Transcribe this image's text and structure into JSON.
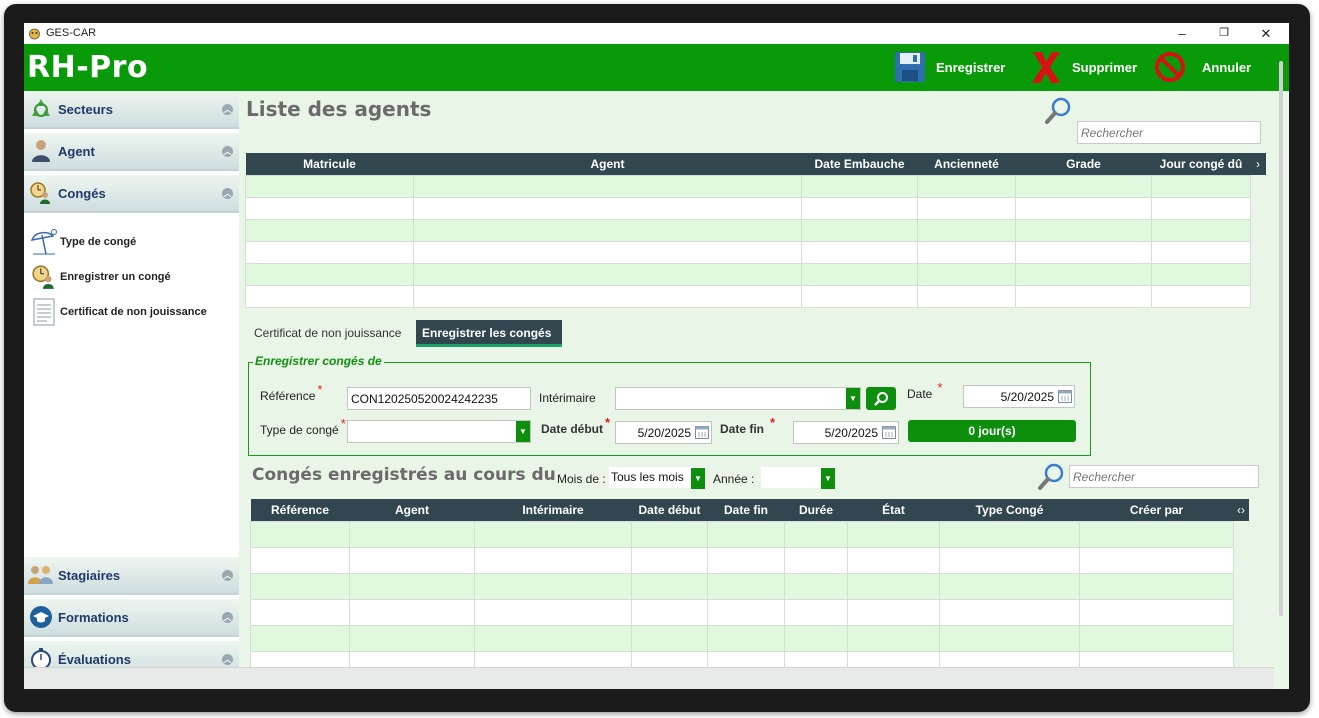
{
  "window": {
    "title": "GES-CAR",
    "minimize": "–",
    "maximize": "❐",
    "close": "✕"
  },
  "header": {
    "brand": "RH-Pro",
    "save_label": "Enregistrer",
    "delete_label": "Supprimer",
    "cancel_label": "Annuler"
  },
  "sidebar": {
    "sections": [
      {
        "label": "Secteurs",
        "icon": "recycle-icon"
      },
      {
        "label": "Agent",
        "icon": "person-icon"
      },
      {
        "label": "Congés",
        "icon": "clock-person-icon"
      }
    ],
    "items": [
      {
        "label": "Type de congé",
        "icon": "beach-icon"
      },
      {
        "label": "Enregistrer un congé",
        "icon": "clock-person-icon"
      },
      {
        "label": "Certificat de non jouissance",
        "icon": "document-icon"
      }
    ],
    "bottom_sections": [
      {
        "label": "Stagiaires",
        "icon": "group-icon"
      },
      {
        "label": "Formations",
        "icon": "graduation-cap-icon"
      },
      {
        "label": "Évaluations",
        "icon": "stopwatch-icon"
      }
    ]
  },
  "agents": {
    "title": "Liste des agents",
    "search_placeholder": "Rechercher",
    "columns": [
      "Matricule",
      "Agent",
      "Date Embauche",
      "Ancienneté",
      "Grade",
      "Jour congé dû"
    ]
  },
  "tabs": [
    {
      "label": "Certificat de non jouissance"
    },
    {
      "label": "Enregistrer les congés"
    }
  ],
  "form": {
    "legend": "Enregistrer congés de",
    "reference_label": "Référence",
    "reference_value": "CON120250520024242235",
    "interimaire_label": "Intérimaire",
    "date_label": "Date",
    "date_value": "5/20/2025",
    "type_label": "Type de congé",
    "date_debut_label": "Date début",
    "date_debut_value": "5/20/2025",
    "date_fin_label": "Date fin",
    "date_fin_value": "5/20/2025",
    "days": "0 jour(s)"
  },
  "conges": {
    "title": "Congés enregistrés au cours du",
    "mois_label": "Mois de :",
    "mois_value": "Tous les mois",
    "annee_label": "Année :",
    "search_placeholder": "Rechercher",
    "columns": [
      "Référence",
      "Agent",
      "Intérimaire",
      "Date début",
      "Date fin",
      "Durée",
      "État",
      "Type Congé",
      "Créer par"
    ]
  },
  "colors": {
    "header_green": "#099a09",
    "table_header": "#324650",
    "row_green": "#e0f8dd",
    "required_red": "#e02020"
  }
}
